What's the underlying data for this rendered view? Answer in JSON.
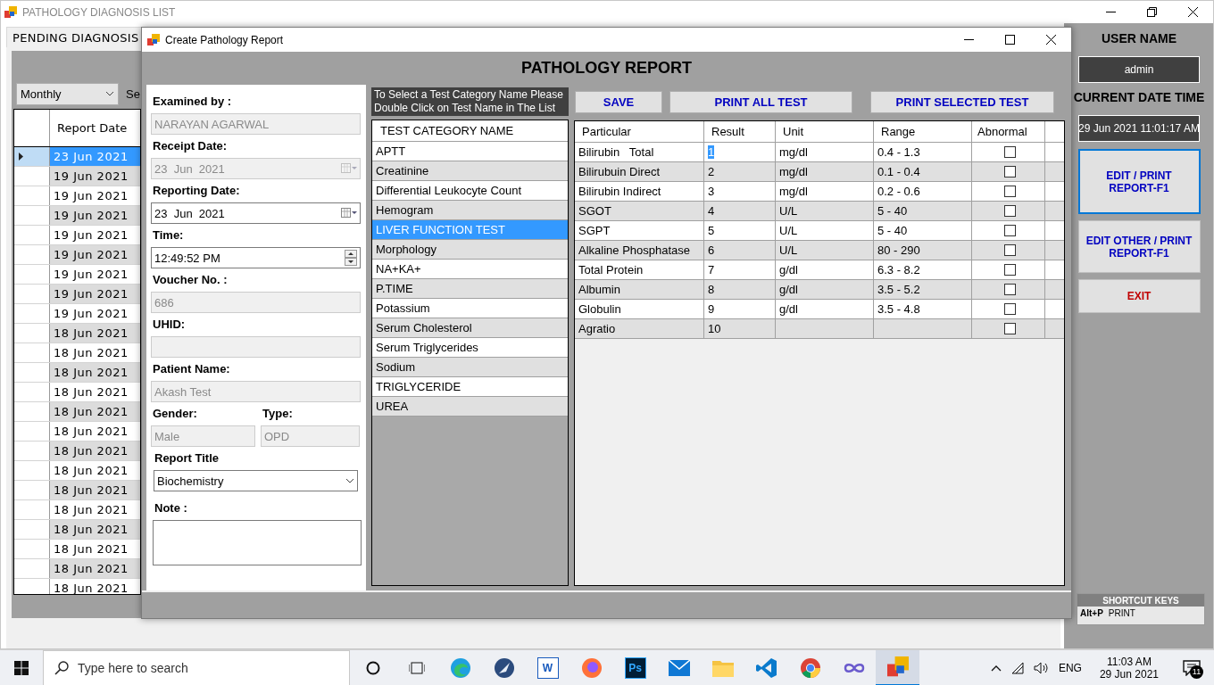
{
  "main_window": {
    "title": "PATHOLOGY DIAGNOSIS LIST"
  },
  "pending_tab": {
    "label": "PENDING DIAGNOSIS",
    "selected": true
  },
  "filter": {
    "value": "Monthly",
    "search_label": "Se"
  },
  "diagnosis_grid": {
    "columns": [
      "Report Date"
    ],
    "rows": [
      {
        "date": "23 Jun 2021",
        "selected": true
      },
      {
        "date": "19 Jun 2021",
        "selected": false
      },
      {
        "date": "19 Jun 2021",
        "selected": false
      },
      {
        "date": "19 Jun 2021",
        "selected": false
      },
      {
        "date": "19 Jun 2021",
        "selected": false
      },
      {
        "date": "19 Jun 2021",
        "selected": false
      },
      {
        "date": "19 Jun 2021",
        "selected": false
      },
      {
        "date": "19 Jun 2021",
        "selected": false
      },
      {
        "date": "19 Jun 2021",
        "selected": false
      },
      {
        "date": "18 Jun 2021",
        "selected": false
      },
      {
        "date": "18 Jun 2021",
        "selected": false
      },
      {
        "date": "18 Jun 2021",
        "selected": false
      },
      {
        "date": "18 Jun 2021",
        "selected": false
      },
      {
        "date": "18 Jun 2021",
        "selected": false
      },
      {
        "date": "18 Jun 2021",
        "selected": false
      },
      {
        "date": "18 Jun 2021",
        "selected": false
      },
      {
        "date": "18 Jun 2021",
        "selected": false
      },
      {
        "date": "18 Jun 2021",
        "selected": false
      },
      {
        "date": "18 Jun 2021",
        "selected": false
      },
      {
        "date": "18 Jun 2021",
        "selected": false
      },
      {
        "date": "18 Jun 2021",
        "selected": false
      },
      {
        "date": "18 Jun 2021",
        "selected": false
      },
      {
        "date": "18 Jun 2021",
        "selected": false
      }
    ]
  },
  "side_panel": {
    "user_label": "USER NAME",
    "user": "admin",
    "datetime_label": "CURRENT DATE TIME",
    "datetime": "29 Jun 2021 11:01:17 AM",
    "buttons": [
      {
        "label": "EDIT / PRINT REPORT-F1",
        "kind": "action",
        "focused": true
      },
      {
        "label": "EDIT OTHER / PRINT REPORT-F1",
        "kind": "action",
        "focused": false
      },
      {
        "label": "EXIT",
        "kind": "exit",
        "focused": false
      }
    ]
  },
  "shortcut_keys": {
    "title": "SHORTCUT KEYS",
    "items": [
      {
        "key": "Alt+P",
        "action": "PRINT"
      }
    ]
  },
  "dialog": {
    "title": "Create Pathology Report",
    "heading": "PATHOLOGY REPORT",
    "form": {
      "fields": [
        {
          "kind": "text",
          "label": "Examined by :",
          "value": "NARAYAN AGARWAL",
          "disabled": true
        },
        {
          "kind": "date",
          "label": "Receipt Date:",
          "value": "23  Jun  2021",
          "disabled": true
        },
        {
          "kind": "date",
          "label": "Reporting Date:",
          "value": "23  Jun  2021",
          "disabled": false
        },
        {
          "kind": "time",
          "label": "Time:",
          "value": "12:49:52 PM",
          "disabled": false
        },
        {
          "kind": "text",
          "label": "Voucher No. :",
          "value": "686",
          "disabled": true
        },
        {
          "kind": "text",
          "label": "UHID:",
          "disabled": true
        },
        {
          "kind": "text",
          "label": "Patient Name:",
          "value": "Akash Test",
          "disabled": true
        },
        {
          "kind": "pair",
          "fields": [
            {
              "label": "Gender:",
              "value": "Male",
              "disabled": true
            },
            {
              "label": "Type:",
              "value": "OPD",
              "disabled": true
            }
          ]
        },
        {
          "kind": "select",
          "label": "Report Title",
          "value": "Biochemistry",
          "disabled": false
        },
        {
          "kind": "note",
          "label": "Note :",
          "disabled": false
        }
      ]
    },
    "hint": "To Select a Test Category Name Please Double Click on Test Name in The List",
    "categories": {
      "header": "TEST CATEGORY NAME",
      "items": [
        {
          "name": "APTT",
          "selected": false
        },
        {
          "name": "Creatinine",
          "selected": false
        },
        {
          "name": "Differential Leukocyte Count",
          "selected": false
        },
        {
          "name": "Hemogram",
          "selected": false
        },
        {
          "name": "LIVER FUNCTION TEST",
          "selected": true
        },
        {
          "name": "Morphology",
          "selected": false
        },
        {
          "name": "NA+KA+",
          "selected": false
        },
        {
          "name": "P.TIME",
          "selected": false
        },
        {
          "name": "Potassium",
          "selected": false
        },
        {
          "name": "Serum Cholesterol",
          "selected": false
        },
        {
          "name": "Serum Triglycerides",
          "selected": false
        },
        {
          "name": "Sodium",
          "selected": false
        },
        {
          "name": "TRIGLYCERIDE",
          "selected": false
        },
        {
          "name": "UREA",
          "selected": false
        }
      ]
    },
    "buttons": [
      "SAVE",
      "PRINT ALL TEST",
      "PRINT SELECTED TEST"
    ],
    "results": {
      "columns": [
        "Particular",
        "Result",
        "Unit",
        "Range",
        "Abnormal"
      ],
      "rows": [
        {
          "particular": "Bilirubin   Total",
          "result": "1",
          "unit": "mg/dl",
          "range": "0.4 - 1.3",
          "abnormal": false,
          "selected": true
        },
        {
          "particular": "Bilirubuin Direct",
          "result": "2",
          "unit": "mg/dl",
          "range": "0.1 - 0.4",
          "abnormal": false,
          "selected": false
        },
        {
          "particular": "Bilirubin Indirect",
          "result": "3",
          "unit": "mg/dl",
          "range": "0.2 - 0.6",
          "abnormal": false,
          "selected": false
        },
        {
          "particular": "SGOT",
          "result": "4",
          "unit": "U/L",
          "range": "5 - 40",
          "abnormal": false,
          "selected": false
        },
        {
          "particular": "SGPT",
          "result": "5",
          "unit": "U/L",
          "range": "5 - 40",
          "abnormal": false,
          "selected": false
        },
        {
          "particular": "Alkaline Phosphatase",
          "result": "6",
          "unit": "U/L",
          "range": "80 - 290",
          "abnormal": false,
          "selected": false
        },
        {
          "particular": "Total Protein",
          "result": "7",
          "unit": "g/dl",
          "range": "6.3 - 8.2",
          "abnormal": false,
          "selected": false
        },
        {
          "particular": "Albumin",
          "result": "8",
          "unit": "g/dl",
          "range": "3.5 - 5.2",
          "abnormal": false,
          "selected": false
        },
        {
          "particular": "Globulin",
          "result": "9",
          "unit": "g/dl",
          "range": "3.5 - 4.8",
          "abnormal": false,
          "selected": false
        },
        {
          "particular": "Agratio",
          "result": "10",
          "abnormal": false,
          "selected": false
        }
      ]
    }
  },
  "taskbar": {
    "search_placeholder": "Type here to search",
    "apps": [
      {
        "kind": "cortana",
        "active": false
      },
      {
        "kind": "taskview",
        "active": false
      },
      {
        "kind": "edge",
        "active": false
      },
      {
        "kind": "feather",
        "active": false
      },
      {
        "kind": "word",
        "label": "W",
        "active": false
      },
      {
        "kind": "firefox",
        "active": false
      },
      {
        "kind": "photoshop",
        "label": "Ps",
        "active": false
      },
      {
        "kind": "mail",
        "active": false
      },
      {
        "kind": "folder",
        "active": false
      },
      {
        "kind": "vscode",
        "active": false
      },
      {
        "kind": "chrome",
        "active": false
      },
      {
        "kind": "infinity",
        "active": false
      },
      {
        "kind": "pathology",
        "active": true
      }
    ],
    "language": "ENG",
    "time": "11:03 AM",
    "date": "29 Jun 2021",
    "notifications": "11"
  }
}
